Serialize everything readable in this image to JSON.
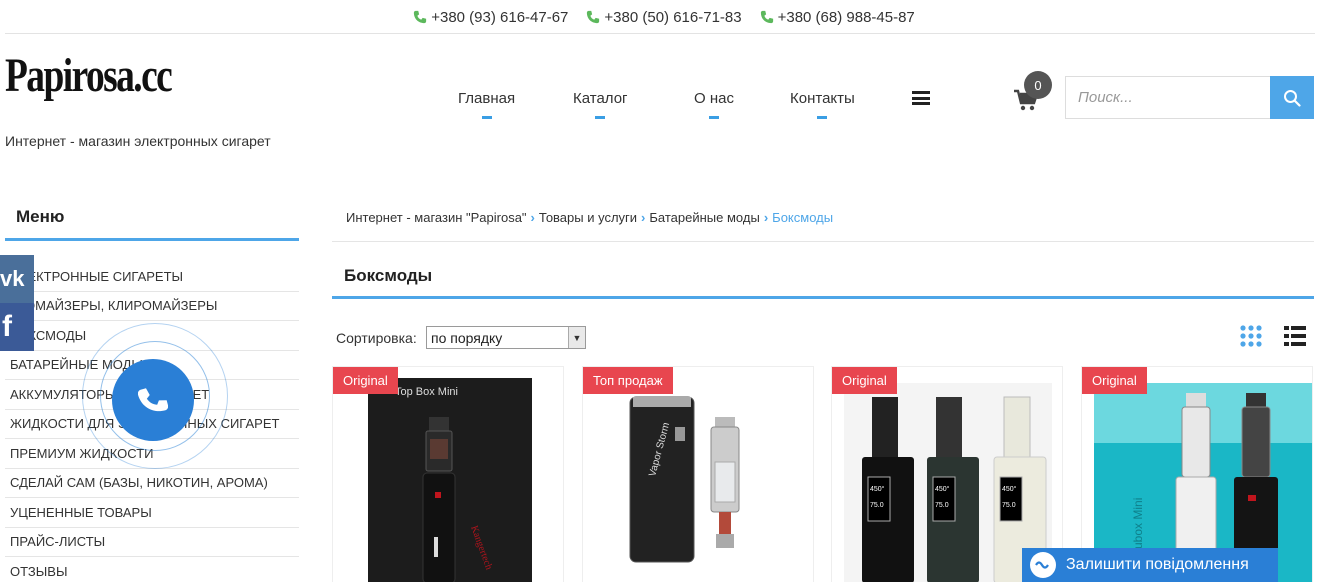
{
  "topbar": {
    "phones": [
      "+380 (93) 616-47-67",
      "+380 (50) 616-71-83",
      "+380 (68) 988-45-87"
    ]
  },
  "header": {
    "logo": "Papirosa.cc",
    "tagline": "Интернет - магазин электронных сигарет",
    "nav": [
      "Главная",
      "Каталог",
      "О нас",
      "Контакты"
    ],
    "cart_count": "0",
    "search_placeholder": "Поиск..."
  },
  "sidebar": {
    "title": "Меню",
    "items": [
      "ЭЛЕКТРОННЫЕ СИГАРЕТЫ",
      "АТОМАЙЗЕРЫ, КЛИРОМАЙЗЕРЫ",
      "БОКСМОДЫ",
      "БАТАРЕЙНЫЕ МОДЫ",
      "АККУМУЛЯТОРЫ ДЛЯ СИГАРЕТ",
      "ЖИДКОСТИ ДЛЯ ЭЛЕКТРОННЫХ СИГАРЕТ",
      "ПРЕМИУМ ЖИДКОСТИ",
      "СДЕЛАЙ САМ (БАЗЫ, НИКОТИН, АРОМА)",
      "УЦЕНЕННЫЕ ТОВАРЫ",
      "ПРАЙС-ЛИСТЫ",
      "ОТЗЫВЫ"
    ],
    "social": {
      "vk": "vk",
      "fb": "f"
    }
  },
  "breadcrumb": [
    "Интернет - магазин \"Papirosa\"",
    "Товары и услуги",
    "Батарейные моды",
    "Боксмоды"
  ],
  "main": {
    "title": "Боксмоды",
    "sort_label": "Сортировка:",
    "sort_value": "по порядку"
  },
  "products": [
    {
      "badge": "Original",
      "image_text": "Top Box Mini"
    },
    {
      "badge": "Топ продаж",
      "image_text": "Vapor Storm"
    },
    {
      "badge": "Original",
      "image_text": ""
    },
    {
      "badge": "Original",
      "image_text": "Subox Mini"
    }
  ],
  "chat_widget": {
    "label": "Залишити повідомлення"
  },
  "colors": {
    "accent": "#4ea6e8",
    "badge": "#e8464f",
    "callback": "#2a7fd6"
  }
}
